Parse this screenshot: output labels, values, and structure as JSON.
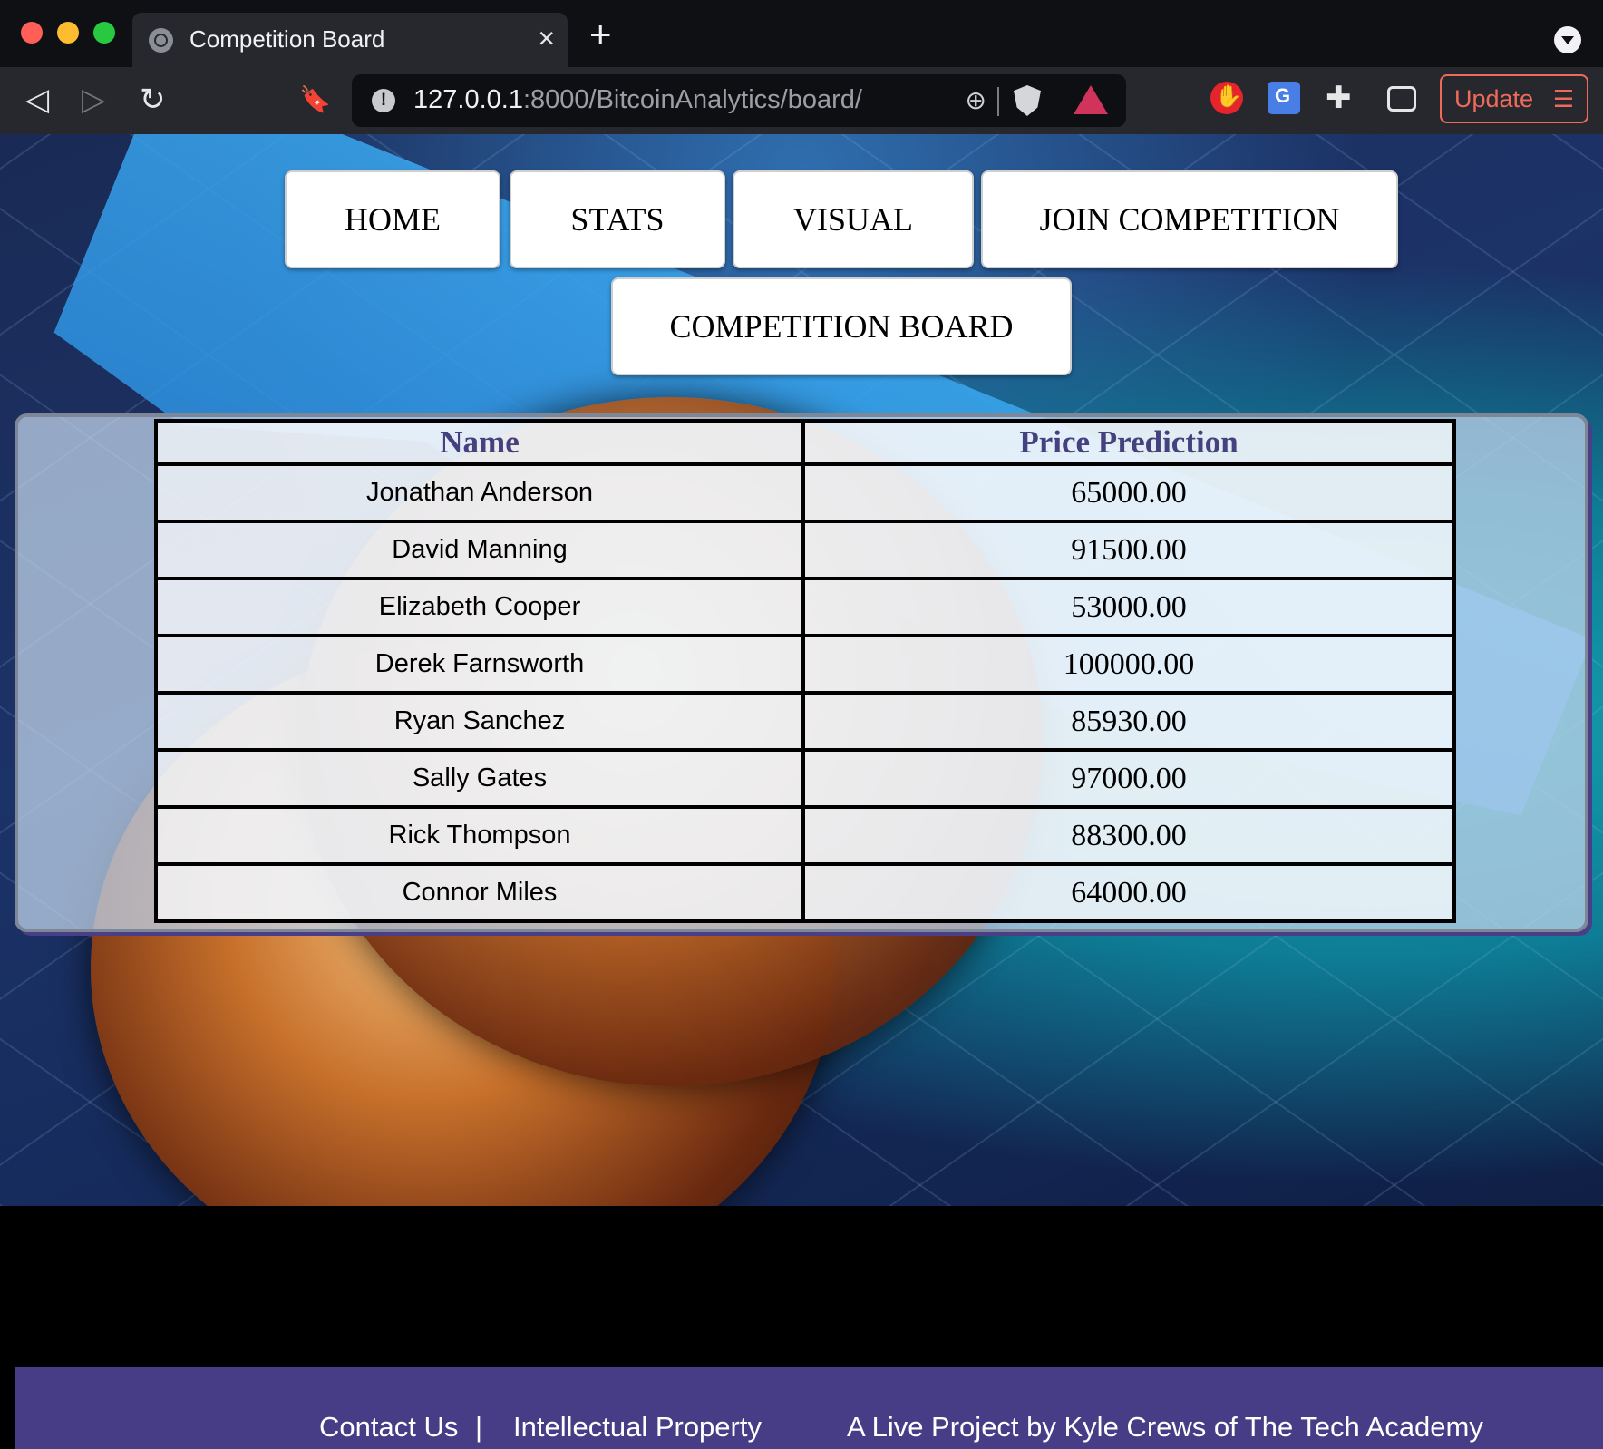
{
  "browser": {
    "tab_title": "Competition Board",
    "tab_close": "×",
    "new_tab": "+",
    "url_host": "127.0.0.1",
    "url_rest": ":8000/BitcoinAnalytics/board/",
    "update_label": "Update",
    "back": "◁",
    "forward": "▷",
    "reload": "↻",
    "bookmark": "🔖",
    "zoom": "⊕",
    "update_menu": "☰"
  },
  "nav": {
    "home": "HOME",
    "stats": "STATS",
    "visual": "VISUAL",
    "join": "JOIN COMPETITION",
    "board": "COMPETITION BOARD"
  },
  "table": {
    "columns": [
      "Name",
      "Price Prediction"
    ],
    "rows": [
      {
        "name": "Jonathan Anderson",
        "price": "65000.00"
      },
      {
        "name": "David Manning",
        "price": "91500.00"
      },
      {
        "name": "Elizabeth Cooper",
        "price": "53000.00"
      },
      {
        "name": "Derek Farnsworth",
        "price": "100000.00"
      },
      {
        "name": "Ryan Sanchez",
        "price": "85930.00"
      },
      {
        "name": "Sally Gates",
        "price": "97000.00"
      },
      {
        "name": "Rick Thompson",
        "price": "88300.00"
      },
      {
        "name": "Connor Miles",
        "price": "64000.00"
      }
    ]
  },
  "footer": {
    "contact": "Contact Us",
    "separator": "|",
    "ip": "Intellectual Property",
    "credit": "A Live Project by Kyle Crews of The Tech Academy"
  },
  "colors": {
    "header_text": "#45407e",
    "footer_bg": "#463d86",
    "update_accent": "#f06a5b"
  }
}
